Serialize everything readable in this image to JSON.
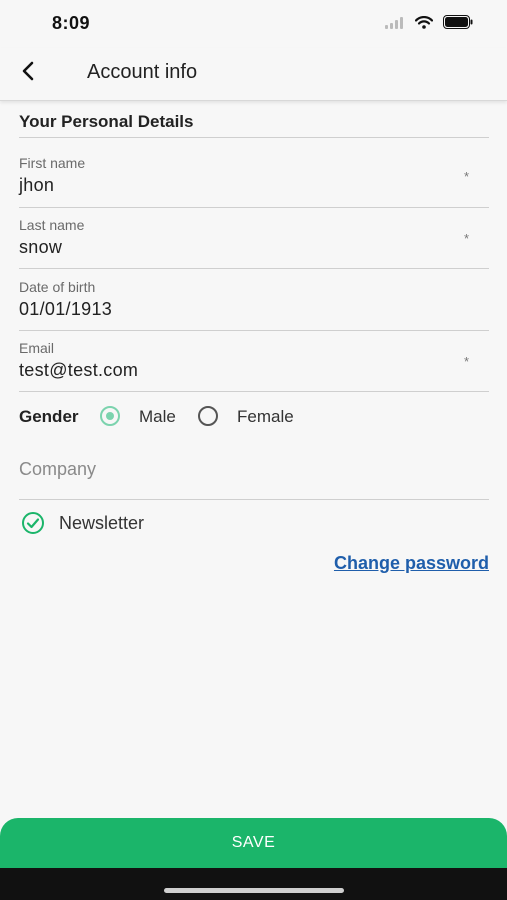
{
  "status_bar": {
    "time": "8:09"
  },
  "header": {
    "title": "Account info",
    "back_icon": "chevron-left-icon"
  },
  "section": {
    "title": "Your Personal Details"
  },
  "fields": [
    {
      "label": "First name",
      "value": "jhon",
      "required_mark": "*"
    },
    {
      "label": "Last name",
      "value": "snow",
      "required_mark": "*"
    },
    {
      "label": "Date of birth",
      "value": "01/01/1913"
    },
    {
      "label": "Email",
      "value": "test@test.com",
      "required_mark": "*"
    }
  ],
  "gender": {
    "label": "Gender",
    "options": [
      {
        "label": "Male",
        "selected": true
      },
      {
        "label": "Female",
        "selected": false
      }
    ]
  },
  "company": {
    "placeholder": "Company"
  },
  "newsletter": {
    "label": "Newsletter",
    "checked": true
  },
  "change_password": {
    "label": "Change password"
  },
  "save": {
    "label": "SAVE"
  },
  "colors": {
    "accent_green": "#1bb56a",
    "radio_green": "#7cd3ae",
    "link_blue": "#1f5eab"
  }
}
